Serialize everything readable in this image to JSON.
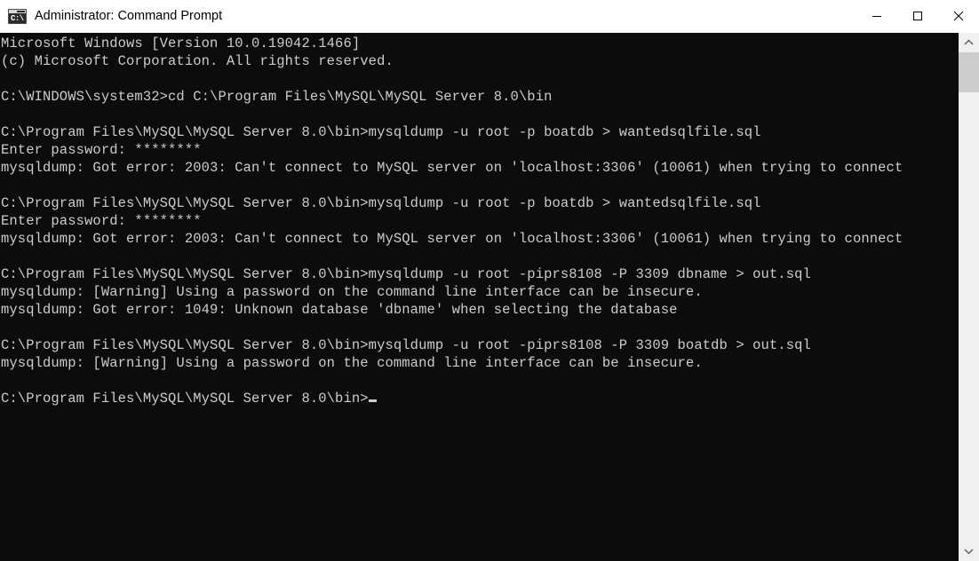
{
  "window": {
    "title": "Administrator: Command Prompt",
    "icon": "console-icon",
    "icon_glyph": "C:\\",
    "background_color": "#0c0c0c",
    "text_color": "#cccccc",
    "titlebar_color": "#ffffff"
  },
  "controls": {
    "minimize_label": "Minimize",
    "maximize_label": "Maximize",
    "close_label": "Close"
  },
  "scrollbar": {
    "up_arrow_label": "Scroll up",
    "down_arrow_label": "Scroll down",
    "thumb_label": "Scroll thumb"
  },
  "terminal": {
    "prompt": "C:\\Program Files\\MySQL\\MySQL Server 8.0\\bin>",
    "lines": [
      "Microsoft Windows [Version 10.0.19042.1466]",
      "(c) Microsoft Corporation. All rights reserved.",
      "",
      "C:\\WINDOWS\\system32>cd C:\\Program Files\\MySQL\\MySQL Server 8.0\\bin",
      "",
      "C:\\Program Files\\MySQL\\MySQL Server 8.0\\bin>mysqldump -u root -p boatdb > wantedsqlfile.sql",
      "Enter password: ********",
      "mysqldump: Got error: 2003: Can't connect to MySQL server on 'localhost:3306' (10061) when trying to connect",
      "",
      "C:\\Program Files\\MySQL\\MySQL Server 8.0\\bin>mysqldump -u root -p boatdb > wantedsqlfile.sql",
      "Enter password: ********",
      "mysqldump: Got error: 2003: Can't connect to MySQL server on 'localhost:3306' (10061) when trying to connect",
      "",
      "C:\\Program Files\\MySQL\\MySQL Server 8.0\\bin>mysqldump -u root -piprs8108 -P 3309 dbname > out.sql",
      "mysqldump: [Warning] Using a password on the command line interface can be insecure.",
      "mysqldump: Got error: 1049: Unknown database 'dbname' when selecting the database",
      "",
      "C:\\Program Files\\MySQL\\MySQL Server 8.0\\bin>mysqldump -u root -piprs8108 -P 3309 boatdb > out.sql",
      "mysqldump: [Warning] Using a password on the command line interface can be insecure.",
      ""
    ],
    "current_input": ""
  }
}
